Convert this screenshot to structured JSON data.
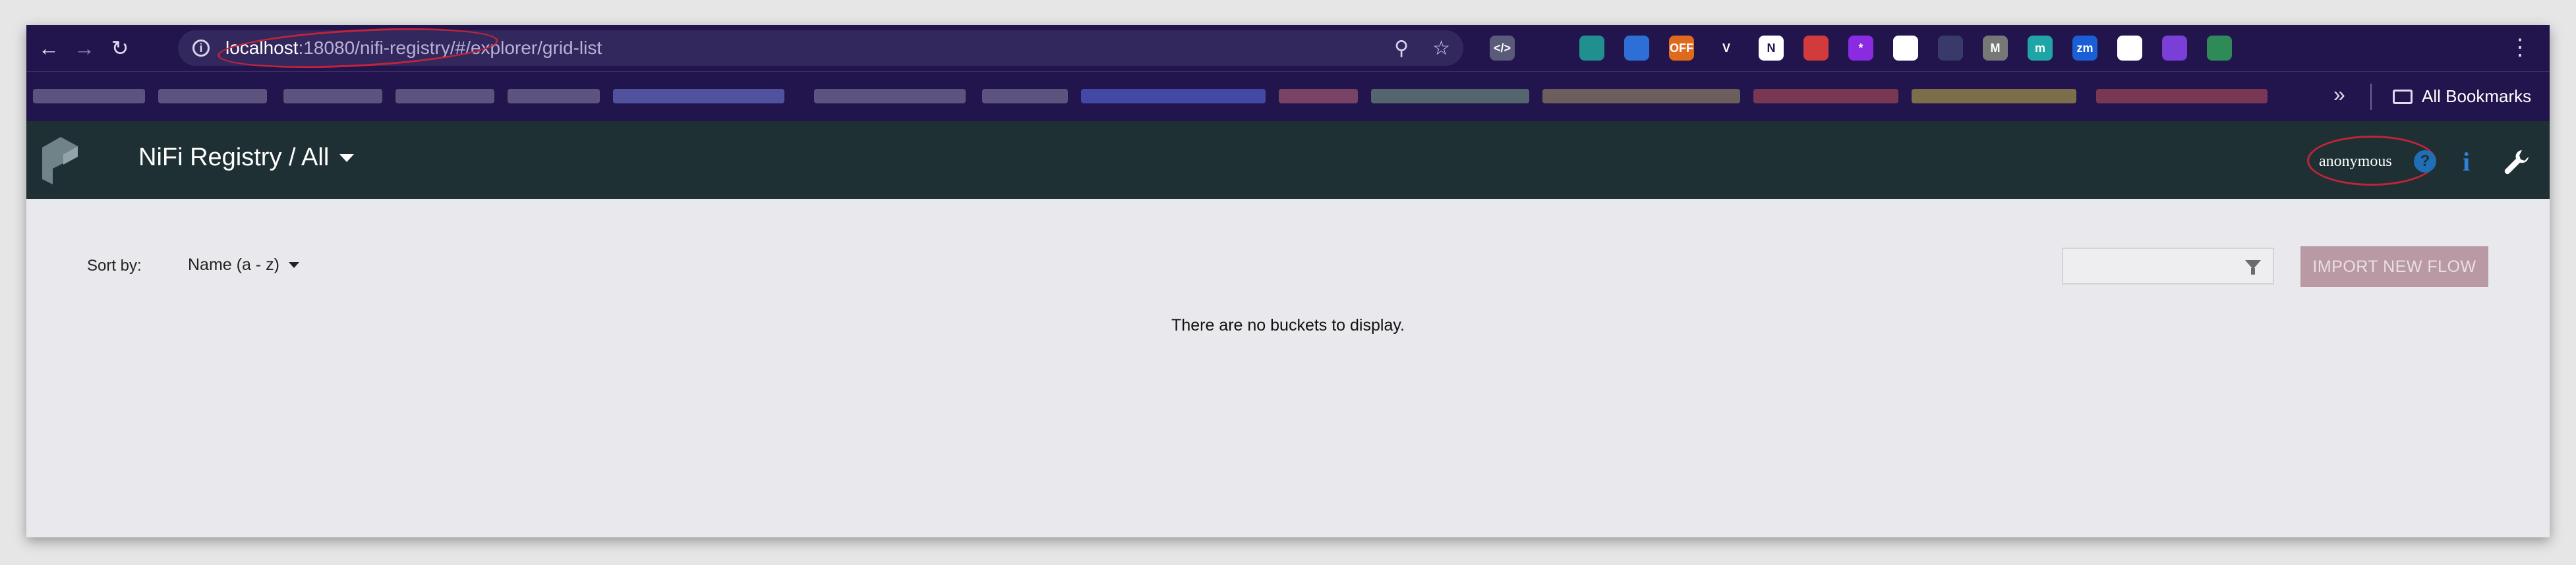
{
  "browser": {
    "url_host": "localhost",
    "url_rest": ":18080/nifi-registry/#/explorer/grid-list",
    "extensions": [
      {
        "icon": "code-extension-icon",
        "color": "#5a5a7a",
        "label": "</>"
      },
      {
        "icon": "pin-extension-icon",
        "color": "#22144d",
        "label": ""
      },
      {
        "icon": "globe-extension-icon",
        "color": "#1f8f8f",
        "label": ""
      },
      {
        "icon": "translate-extension-icon",
        "color": "#2d6fd6",
        "label": ""
      },
      {
        "icon": "off-extension-icon",
        "color": "#e06a1b",
        "label": "OFF"
      },
      {
        "icon": "vue-extension-icon",
        "color": "#22144d",
        "label": "V"
      },
      {
        "icon": "notion-extension-icon",
        "color": "#ffffff",
        "label": "N"
      },
      {
        "icon": "red-extension-icon",
        "color": "#d23b3b",
        "label": ""
      },
      {
        "icon": "star-extension-icon",
        "color": "#8a2be2",
        "label": "*"
      },
      {
        "icon": "round-extension-icon",
        "color": "#ffffff",
        "label": ""
      },
      {
        "icon": "book-extension-icon",
        "color": "#3a3a6a",
        "label": ""
      },
      {
        "icon": "m-extension-icon",
        "color": "#777777",
        "label": "M"
      },
      {
        "icon": "m-circle-extension-icon",
        "color": "#1fa5a5",
        "label": "m"
      },
      {
        "icon": "zm-extension-icon",
        "color": "#1a5fd6",
        "label": "zm"
      },
      {
        "icon": "github-extension-icon",
        "color": "#ffffff",
        "label": ""
      },
      {
        "icon": "puzzle-purple-extension-icon",
        "color": "#7a3fd6",
        "label": ""
      },
      {
        "icon": "download-extension-icon",
        "color": "#2e8b57",
        "label": ""
      },
      {
        "icon": "extensions-icon",
        "color": "#22144d",
        "label": ""
      }
    ],
    "all_bookmarks_label": "All Bookmarks"
  },
  "app": {
    "title": "NiFi Registry / All",
    "user": "anonymous"
  },
  "explorer": {
    "sort_label": "Sort by:",
    "sort_value": "Name (a - z)",
    "filter_placeholder": "",
    "import_button": "IMPORT NEW FLOW",
    "empty_message": "There are no buckets to display."
  },
  "colors": {
    "browser_bg": "#22144d",
    "header_bg": "#1f3034",
    "import_button_bg": "#b99aa4",
    "annotation": "#c0243a"
  }
}
